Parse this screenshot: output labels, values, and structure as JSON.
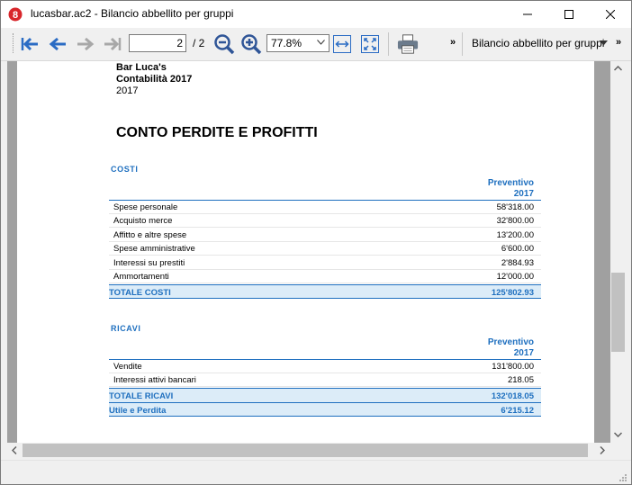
{
  "window": {
    "title": "lucasbar.ac2 - Bilancio abbellito per gruppi"
  },
  "toolbar": {
    "page_current": "2",
    "page_total": "/ 2",
    "zoom": "77.8%",
    "overflow_label": "»",
    "report_name": "Bilancio abbellito per gruppi",
    "report_overflow": "»"
  },
  "report": {
    "company": "Bar Luca's",
    "subtitle": "Contabilità 2017",
    "year": "2017",
    "title": "CONTO PERDITE E PROFITTI",
    "costs": {
      "label": "COSTI",
      "column_head": "Preventivo",
      "column_year": "2017",
      "rows": [
        {
          "label": "Spese personale",
          "value": "58'318.00"
        },
        {
          "label": "Acquisto merce",
          "value": "32'800.00"
        },
        {
          "label": "Affitto e altre spese",
          "value": "13'200.00"
        },
        {
          "label": "Spese amministrative",
          "value": "6'600.00"
        },
        {
          "label": "Interessi su prestiti",
          "value": "2'884.93"
        },
        {
          "label": "Ammortamenti",
          "value": "12'000.00"
        }
      ],
      "total_label": "TOTALE COSTI",
      "total_value": "125'802.93"
    },
    "revenues": {
      "label": "RICAVI",
      "column_head": "Preventivo",
      "column_year": "2017",
      "rows": [
        {
          "label": "Vendite",
          "value": "131'800.00"
        },
        {
          "label": "Interessi attivi bancari",
          "value": "218.05"
        }
      ],
      "total_label": "TOTALE RICAVI",
      "total_value": "132'018.05"
    },
    "result": {
      "label": "Utile e Perdita",
      "value": "6'215.12"
    }
  },
  "colors": {
    "accent": "#1e6fbf",
    "total_bg": "#dcecf8",
    "nav_blue": "#2b6cc4"
  }
}
